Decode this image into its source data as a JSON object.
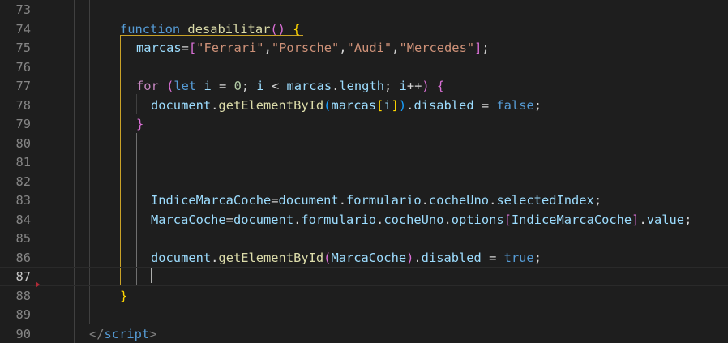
{
  "editor": {
    "lines": [
      {
        "number": "73",
        "tokens": []
      },
      {
        "number": "74",
        "tokens": [
          {
            "t": "function",
            "c": "kw"
          },
          {
            "t": " ",
            "c": "op"
          },
          {
            "t": "desabilitar",
            "c": "fn"
          },
          {
            "t": "()",
            "c": "b2"
          },
          {
            "t": " ",
            "c": "op"
          },
          {
            "t": "{",
            "c": "b1"
          }
        ]
      },
      {
        "number": "75",
        "tokens": [
          {
            "t": "marcas",
            "c": "var"
          },
          {
            "t": "=",
            "c": "op"
          },
          {
            "t": "[",
            "c": "b2"
          },
          {
            "t": "\"Ferrari\"",
            "c": "str"
          },
          {
            "t": ",",
            "c": "op"
          },
          {
            "t": "\"Porsche\"",
            "c": "str"
          },
          {
            "t": ",",
            "c": "op"
          },
          {
            "t": "\"Audi\"",
            "c": "str"
          },
          {
            "t": ",",
            "c": "op"
          },
          {
            "t": "\"Mercedes\"",
            "c": "str"
          },
          {
            "t": "]",
            "c": "b2"
          },
          {
            "t": ";",
            "c": "op"
          }
        ]
      },
      {
        "number": "76",
        "tokens": []
      },
      {
        "number": "77",
        "tokens": [
          {
            "t": "for",
            "c": "ctl"
          },
          {
            "t": " ",
            "c": "op"
          },
          {
            "t": "(",
            "c": "b2"
          },
          {
            "t": "let",
            "c": "kw"
          },
          {
            "t": " ",
            "c": "op"
          },
          {
            "t": "i",
            "c": "var"
          },
          {
            "t": " = ",
            "c": "op"
          },
          {
            "t": "0",
            "c": "num"
          },
          {
            "t": "; ",
            "c": "op"
          },
          {
            "t": "i",
            "c": "var"
          },
          {
            "t": " < ",
            "c": "op"
          },
          {
            "t": "marcas",
            "c": "var"
          },
          {
            "t": ".",
            "c": "op"
          },
          {
            "t": "length",
            "c": "var"
          },
          {
            "t": "; ",
            "c": "op"
          },
          {
            "t": "i",
            "c": "var"
          },
          {
            "t": "++",
            "c": "op"
          },
          {
            "t": ")",
            "c": "b2"
          },
          {
            "t": " ",
            "c": "op"
          },
          {
            "t": "{",
            "c": "b2"
          }
        ]
      },
      {
        "number": "78",
        "tokens": [
          {
            "t": "document",
            "c": "var"
          },
          {
            "t": ".",
            "c": "op"
          },
          {
            "t": "getElementById",
            "c": "fn"
          },
          {
            "t": "(",
            "c": "b3"
          },
          {
            "t": "marcas",
            "c": "var"
          },
          {
            "t": "[",
            "c": "b1"
          },
          {
            "t": "i",
            "c": "var"
          },
          {
            "t": "]",
            "c": "b1"
          },
          {
            "t": ")",
            "c": "b3"
          },
          {
            "t": ".",
            "c": "op"
          },
          {
            "t": "disabled",
            "c": "var"
          },
          {
            "t": " = ",
            "c": "op"
          },
          {
            "t": "false",
            "c": "kw"
          },
          {
            "t": ";",
            "c": "op"
          }
        ]
      },
      {
        "number": "79",
        "tokens": [
          {
            "t": "}",
            "c": "b2"
          }
        ]
      },
      {
        "number": "80",
        "tokens": []
      },
      {
        "number": "81",
        "tokens": []
      },
      {
        "number": "82",
        "tokens": []
      },
      {
        "number": "83",
        "tokens": [
          {
            "t": "IndiceMarcaCoche",
            "c": "var"
          },
          {
            "t": "=",
            "c": "op"
          },
          {
            "t": "document",
            "c": "var"
          },
          {
            "t": ".",
            "c": "op"
          },
          {
            "t": "formulario",
            "c": "var"
          },
          {
            "t": ".",
            "c": "op"
          },
          {
            "t": "cocheUno",
            "c": "var"
          },
          {
            "t": ".",
            "c": "op"
          },
          {
            "t": "selectedIndex",
            "c": "var"
          },
          {
            "t": ";",
            "c": "op"
          }
        ]
      },
      {
        "number": "84",
        "tokens": [
          {
            "t": "MarcaCoche",
            "c": "var"
          },
          {
            "t": "=",
            "c": "op"
          },
          {
            "t": "document",
            "c": "var"
          },
          {
            "t": ".",
            "c": "op"
          },
          {
            "t": "formulario",
            "c": "var"
          },
          {
            "t": ".",
            "c": "op"
          },
          {
            "t": "cocheUno",
            "c": "var"
          },
          {
            "t": ".",
            "c": "op"
          },
          {
            "t": "options",
            "c": "var"
          },
          {
            "t": "[",
            "c": "b2"
          },
          {
            "t": "IndiceMarcaCoche",
            "c": "var"
          },
          {
            "t": "]",
            "c": "b2"
          },
          {
            "t": ".",
            "c": "op"
          },
          {
            "t": "value",
            "c": "var"
          },
          {
            "t": ";",
            "c": "op"
          }
        ]
      },
      {
        "number": "85",
        "tokens": []
      },
      {
        "number": "86",
        "tokens": [
          {
            "t": "document",
            "c": "var"
          },
          {
            "t": ".",
            "c": "op"
          },
          {
            "t": "getElementById",
            "c": "fn"
          },
          {
            "t": "(",
            "c": "b2"
          },
          {
            "t": "MarcaCoche",
            "c": "var"
          },
          {
            "t": ")",
            "c": "b2"
          },
          {
            "t": ".",
            "c": "op"
          },
          {
            "t": "disabled",
            "c": "var"
          },
          {
            "t": " = ",
            "c": "op"
          },
          {
            "t": "true",
            "c": "kw"
          },
          {
            "t": ";",
            "c": "op"
          }
        ]
      },
      {
        "number": "87",
        "tokens": [],
        "current": true
      },
      {
        "number": "88",
        "tokens": [
          {
            "t": "}",
            "c": "b1"
          }
        ]
      },
      {
        "number": "89",
        "tokens": []
      },
      {
        "number": "90",
        "tokens": [
          {
            "t": "</",
            "c": "tagb"
          },
          {
            "t": "script",
            "c": "tag"
          },
          {
            "t": ">",
            "c": "tagb"
          }
        ]
      }
    ]
  }
}
